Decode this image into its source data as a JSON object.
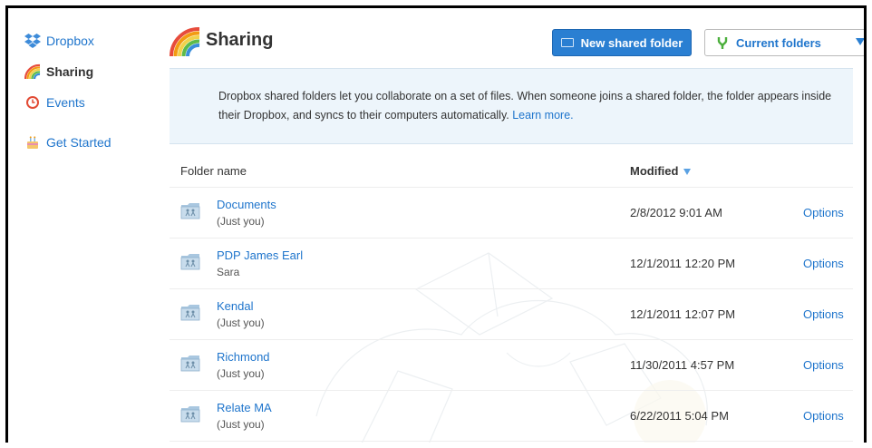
{
  "sidebar": {
    "items": [
      {
        "label": "Dropbox",
        "icon": "dropbox-icon"
      },
      {
        "label": "Sharing",
        "icon": "rainbow-icon"
      },
      {
        "label": "Events",
        "icon": "clock-icon"
      },
      {
        "label": "Get Started",
        "icon": "cake-icon"
      }
    ]
  },
  "header": {
    "title": "Sharing",
    "new_shared_folder_label": "New shared folder",
    "current_folders_label": "Current folders"
  },
  "info": {
    "text": "Dropbox shared folders let you collaborate on a set of files. When someone joins a shared folder, the folder appears inside their Dropbox, and syncs to their computers automatically.",
    "link": "Learn more."
  },
  "table": {
    "col_name": "Folder name",
    "col_modified": "Modified",
    "rows": [
      {
        "name": "Documents",
        "members": "(Just you)",
        "modified": "2/8/2012 9:01 AM",
        "options": "Options"
      },
      {
        "name": "PDP James Earl",
        "members": "Sara",
        "modified": "12/1/2011 12:20 PM",
        "options": "Options"
      },
      {
        "name": "Kendal",
        "members": "(Just you)",
        "modified": "12/1/2011 12:07 PM",
        "options": "Options"
      },
      {
        "name": "Richmond",
        "members": "(Just you)",
        "modified": "11/30/2011 4:57 PM",
        "options": "Options"
      },
      {
        "name": "Relate MA",
        "members": "(Just you)",
        "modified": "6/22/2011 5:04 PM",
        "options": "Options"
      }
    ]
  },
  "colors": {
    "accent": "#2a7fd2",
    "link": "#1f75cc",
    "info_bg": "#edf5fb"
  }
}
